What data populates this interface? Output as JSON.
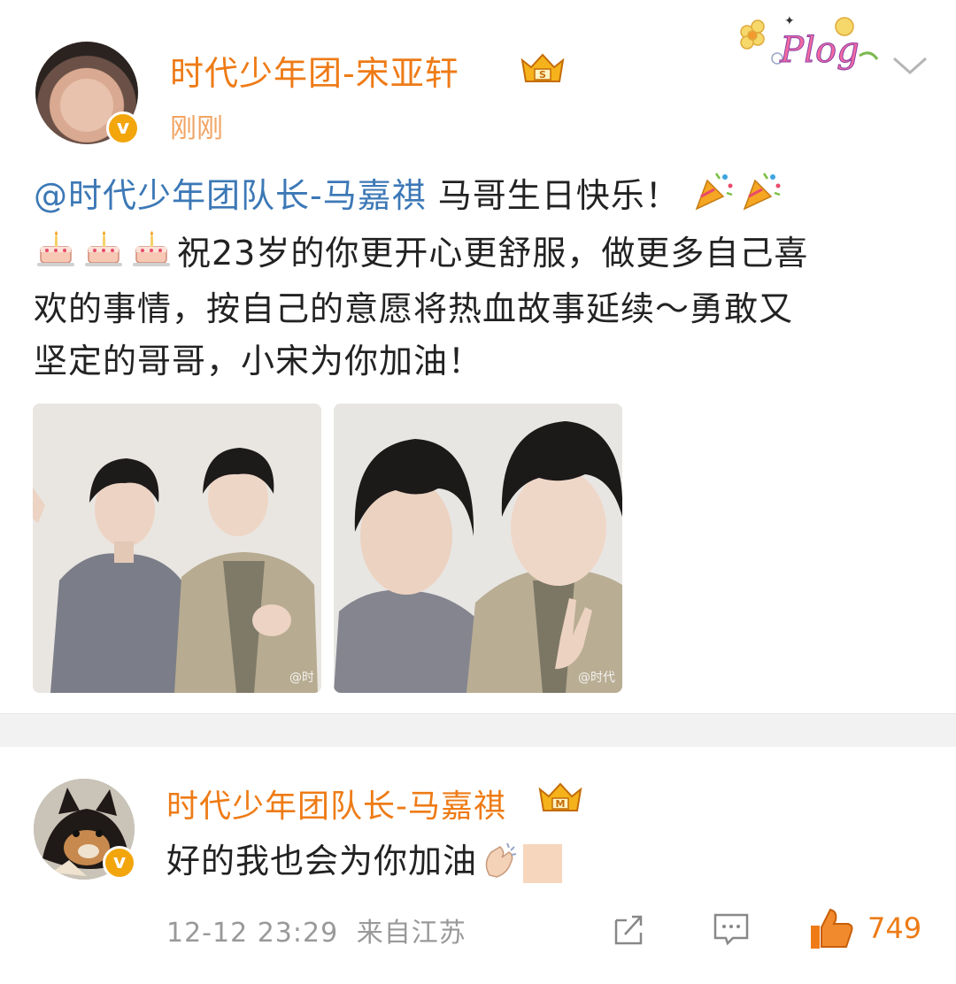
{
  "post": {
    "author": "时代少年团-宋亚轩",
    "time": "刚刚",
    "mention": "@时代少年团队长-马嘉祺",
    "line1_text": " 马哥生日快乐！",
    "line2_text": "祝23岁的你更开心更舒服，做更多自己喜",
    "line3_text": "欢的事情，按自己的意愿将热血故事延续～勇敢又",
    "line4_text": "坚定的哥哥，小宋为你加油！",
    "sticker": "Plog",
    "watermarks": [
      "@时",
      "@时代"
    ]
  },
  "comment": {
    "author": "时代少年团队长-马嘉祺",
    "text": "好的我也会为你加油",
    "date": "12-12 23:29",
    "source": "来自江苏",
    "likes": "749"
  },
  "colors": {
    "username": "#ee7b16",
    "mention": "#3c78b6",
    "time": "#f1a463",
    "meta": "#999999"
  },
  "icons": [
    "vip-crown-icon",
    "verified-v-icon",
    "party-popper-icon",
    "birthday-cake-icon",
    "clap-icon",
    "share-icon",
    "comment-icon",
    "like-icon",
    "chevron-down-icon"
  ]
}
